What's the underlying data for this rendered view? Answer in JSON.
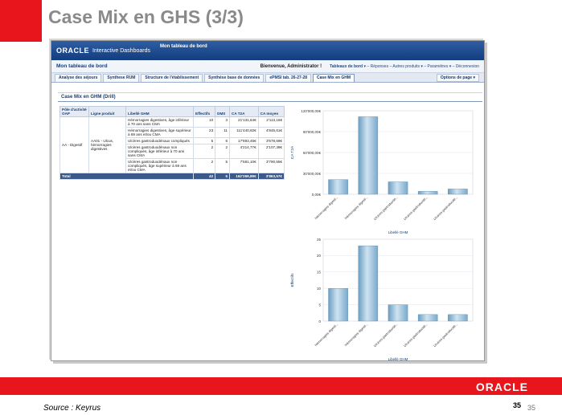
{
  "slide": {
    "title": "Case Mix en GHS (3/3)",
    "source": "Source : Keyrus",
    "page_number": "35",
    "page_number_small": "35",
    "footer_logo": "ORACLE"
  },
  "app": {
    "logo": "ORACLE",
    "product": "Interactive Dashboards",
    "dashboard_name": "Mon tableau de bord",
    "subheader_title": "Mon tableau de bord",
    "welcome": "Bienvenue, Administrator !",
    "links": [
      "Tableaux de bord",
      "Réponses",
      "Autres produits",
      "Paramètres",
      "Déconnexion"
    ]
  },
  "tabs": [
    {
      "label": "Analyse des séjours",
      "active": false
    },
    {
      "label": "Synthese RUM",
      "active": false
    },
    {
      "label": "Structure de l'établissement",
      "active": false
    },
    {
      "label": "Synthèse base de données",
      "active": false
    },
    {
      "label": "ePMSI tab. 26-27-28",
      "active": false
    },
    {
      "label": "Case Mix en GHM",
      "active": true
    }
  ],
  "options_label": "Options de page",
  "section_title": "Case Mix en GHM (Drill)",
  "table": {
    "headers": [
      "Pôle d'activité OAP",
      "Ligne produit",
      "Libellé GHM",
      "Effectifs",
      "DMS",
      "CA T2A",
      "CA moyen"
    ],
    "pole": "AA - Digestif",
    "ligne": "AA01 - Ulcus, hémorragies digestives",
    "rows": [
      {
        "libelle": "Hémorragies digestives, âge inférieur à 70 ans sans CMA",
        "effectifs": "10",
        "dms": "3",
        "ca_t2a": "21'131,64€",
        "ca_moyen": "2'113,16€"
      },
      {
        "libelle": "Hémorragies digestives, âge supérieur à 69 ans et/ou CMA",
        "effectifs": "23",
        "dms": "11",
        "ca_t2a": "111'440,92€",
        "ca_moyen": "4'845,61€"
      },
      {
        "libelle": "Ulcères gastroduodénaux compliqués",
        "effectifs": "5",
        "dms": "6",
        "ca_t2a": "17'893,45€",
        "ca_moyen": "3'578,69€"
      },
      {
        "libelle": "Ulcères gastroduodénaux non compliqués, âge inférieur à 70 ans sans CMA",
        "effectifs": "2",
        "dms": "2",
        "ca_t2a": "4'214,77€",
        "ca_moyen": "2'107,39€"
      },
      {
        "libelle": "Ulcères gastroduodénaux non compliqués, âge supérieur à 69 ans et/ou CMA",
        "effectifs": "2",
        "dms": "5",
        "ca_t2a": "7'581,10€",
        "ca_moyen": "3'790,55€"
      }
    ],
    "total": {
      "label": "Total",
      "effectifs": "42",
      "dms": "5",
      "ca_t2a": "162'269,89€",
      "ca_moyen": "3'863,57€"
    }
  },
  "chart_data": [
    {
      "type": "bar",
      "categories": [
        "Hémorragies digesti...",
        "Hémorragies digesti...",
        "Ulcères gastroduodé...",
        "Ulcères gastroduodé...",
        "Ulcères gastroduodé..."
      ],
      "values": [
        21131.64,
        111440.92,
        17893.45,
        4214.77,
        7581.1
      ],
      "ylabel": "CA T2A",
      "xlabel": "Libellé GHM",
      "ylim": [
        0,
        120000
      ],
      "yticks": [
        "0,00€",
        "30'000,00€",
        "60'000,00€",
        "90'000,00€",
        "120'000,00€"
      ],
      "ytick_values": [
        0,
        30000,
        60000,
        90000,
        120000
      ],
      "bar_color": "#9ec4dd"
    },
    {
      "type": "bar",
      "categories": [
        "Hémorragies digesti...",
        "Hémorragies digesti...",
        "Ulcères gastroduodé...",
        "Ulcères gastroduodé...",
        "Ulcères gastroduodé..."
      ],
      "values": [
        10,
        23,
        5,
        2,
        2
      ],
      "ylabel": "Effectifs",
      "xlabel": "Libellé GHM",
      "ylim": [
        0,
        25
      ],
      "yticks": [
        "0",
        "5",
        "10",
        "15",
        "20",
        "25"
      ],
      "ytick_values": [
        0,
        5,
        10,
        15,
        20,
        25
      ],
      "bar_color": "#9ec4dd"
    }
  ],
  "colors": {
    "brand_red": "#e8161c",
    "header_blue": "#123d80",
    "total_row": "#3b5a89"
  }
}
